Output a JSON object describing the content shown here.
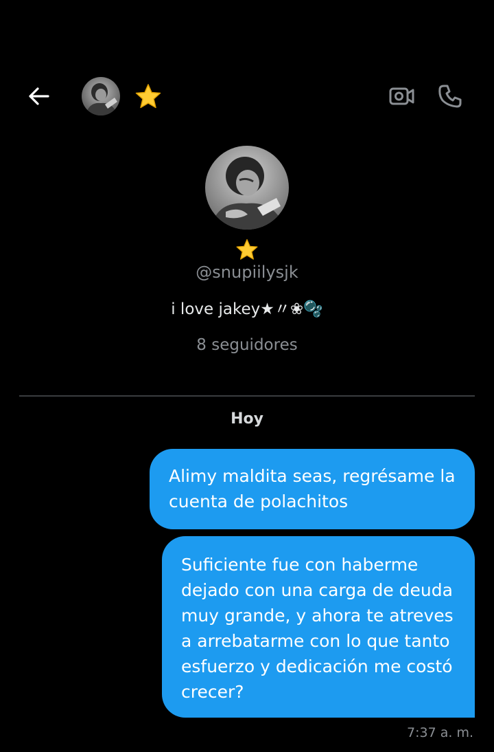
{
  "header": {
    "star_emoji": "⭐",
    "back_icon": "arrow-left-icon",
    "video_icon": "video-camera-icon",
    "call_icon": "phone-icon"
  },
  "profile": {
    "star_emoji": "⭐",
    "handle": "@snupiilysjk",
    "bio": "i love jakey★〃❀🫧",
    "followers": "8 seguidores"
  },
  "conversation": {
    "day_label": "Hoy",
    "messages": [
      {
        "text": "Alimy maldita seas, regrésame la cuenta de polachitos"
      },
      {
        "text": "Suficiente fue con haberme dejado con una carga de deuda muy grande, y ahora te atreves a arrebatarme con lo que tanto esfuerzo y dedicación me costó crecer?"
      }
    ],
    "timestamp": "7:37 a. m."
  },
  "colors": {
    "background": "#000000",
    "bubble": "#1d9bf0",
    "muted_text": "#8b8f94",
    "divider": "#3a3d40"
  }
}
